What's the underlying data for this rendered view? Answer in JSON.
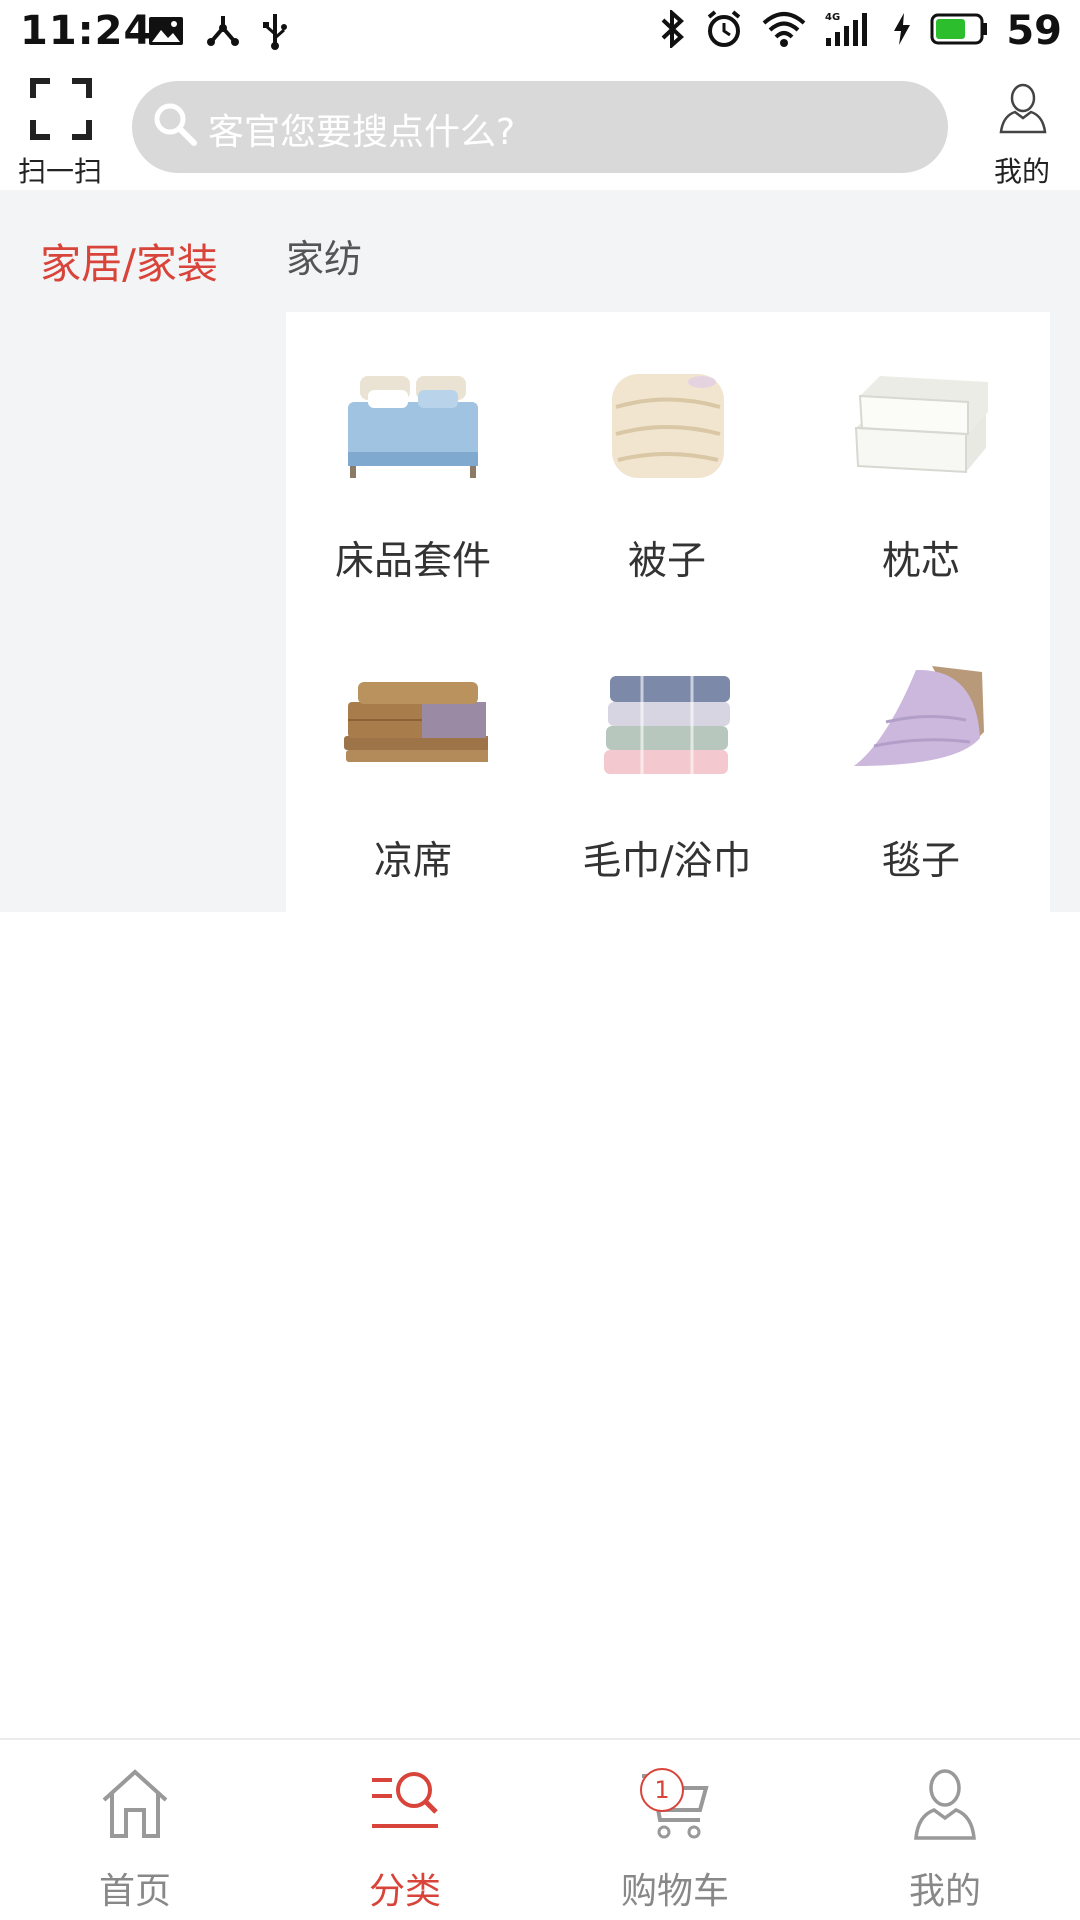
{
  "status_bar": {
    "time": "11:24",
    "battery_level": "59",
    "icons": [
      "image-icon",
      "fork-icon",
      "usb-icon",
      "bluetooth-icon",
      "alarm-icon",
      "wifi-icon",
      "signal-4g-icon",
      "charging-icon",
      "battery-icon"
    ]
  },
  "header": {
    "scan_label": "扫一扫",
    "search_placeholder": "客官您要搜点什么?",
    "mine_label": "我的"
  },
  "sidebar": {
    "items": [
      {
        "label": "家居/家装",
        "active": true
      }
    ]
  },
  "section": {
    "title": "家纺",
    "categories": [
      {
        "label": "床品套件",
        "icon": "bedding-set-image"
      },
      {
        "label": "被子",
        "icon": "quilt-image"
      },
      {
        "label": "枕芯",
        "icon": "pillow-image"
      },
      {
        "label": "凉席",
        "icon": "summer-mat-image"
      },
      {
        "label": "毛巾/浴巾",
        "icon": "towel-image"
      },
      {
        "label": "毯子",
        "icon": "blanket-image"
      }
    ]
  },
  "bottom_nav": {
    "items": [
      {
        "label": "首页",
        "icon": "home-icon",
        "active": false
      },
      {
        "label": "分类",
        "icon": "category-search-icon",
        "active": true
      },
      {
        "label": "购物车",
        "icon": "cart-icon",
        "active": false,
        "badge": "1"
      },
      {
        "label": "我的",
        "icon": "user-icon",
        "active": false
      }
    ]
  },
  "colors": {
    "accent": "#d9443a",
    "content_background": "#f3f4f6",
    "search_background": "#d9d9d9",
    "inactive_nav": "#888888"
  }
}
